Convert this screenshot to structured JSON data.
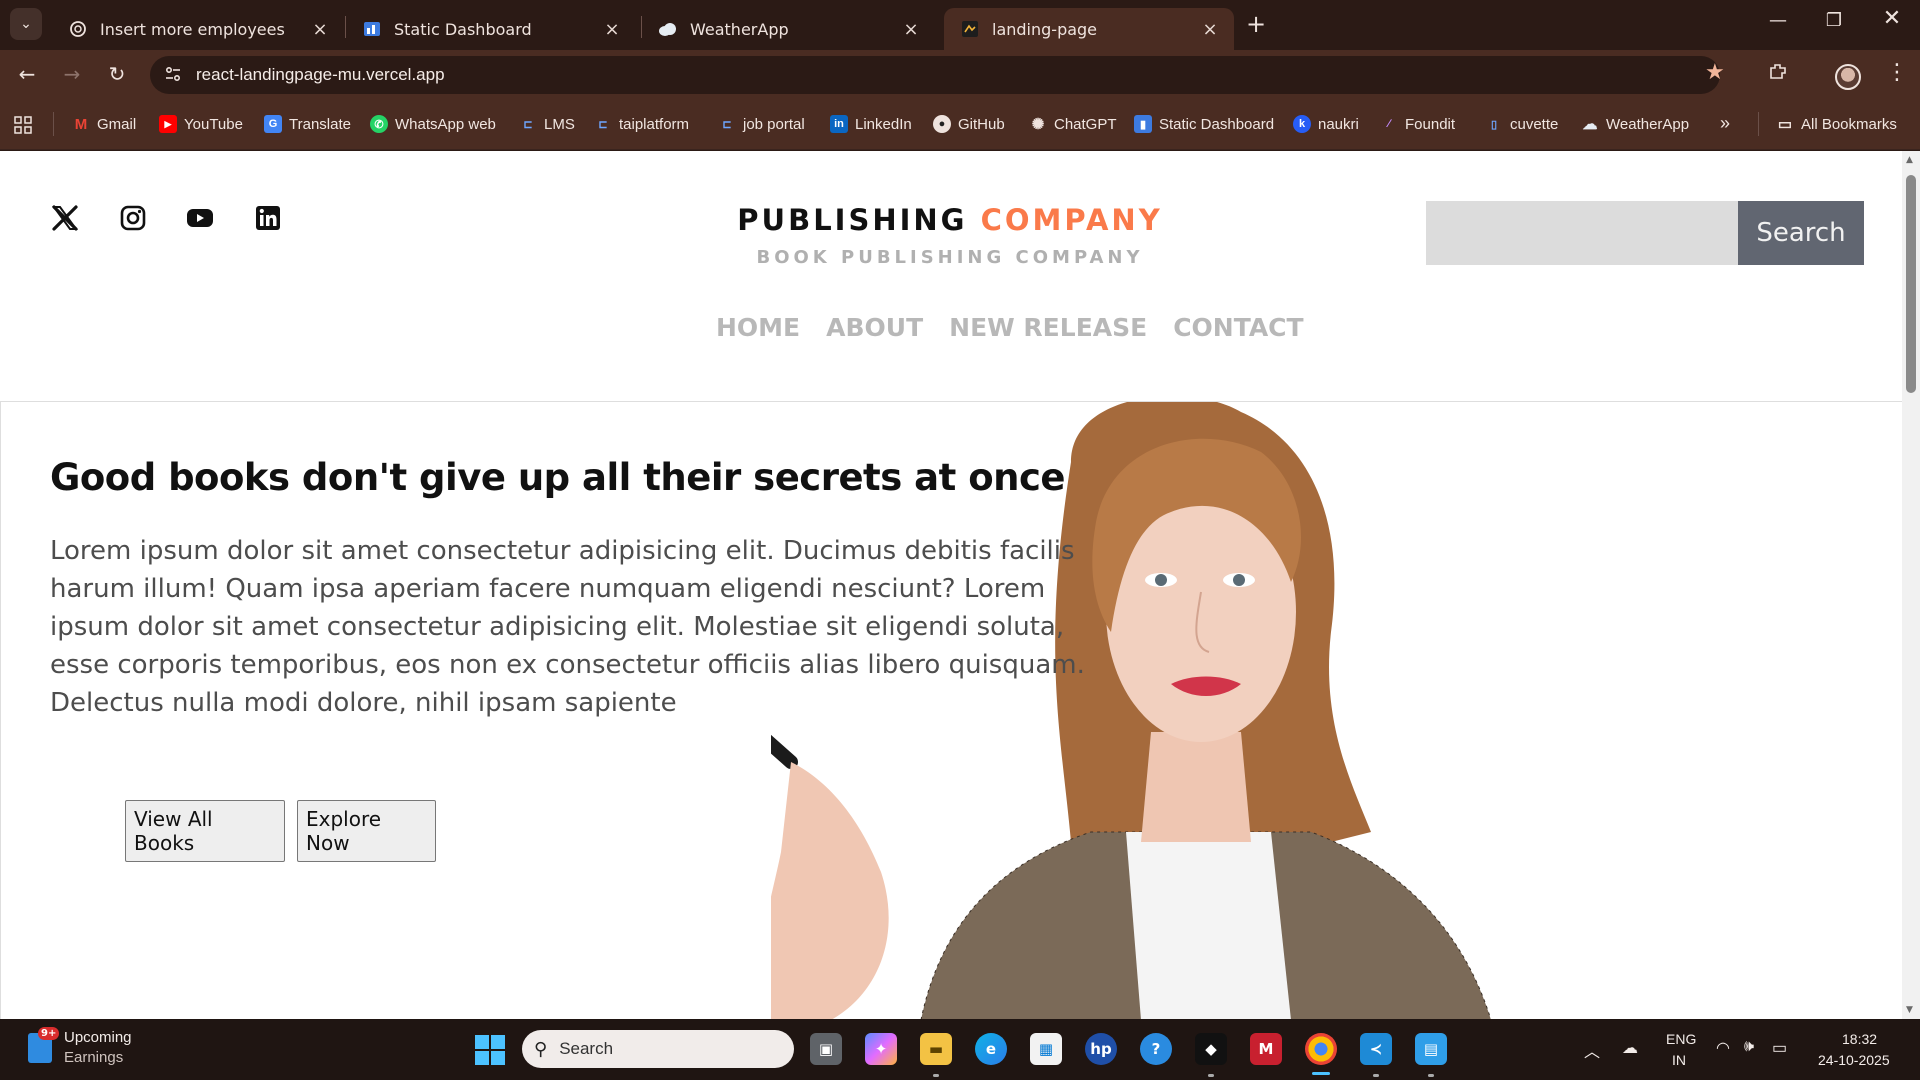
{
  "browser": {
    "tabs": [
      {
        "label": "Insert more employees",
        "icon": "chatgpt-icon",
        "active": false
      },
      {
        "label": "Static Dashboard",
        "icon": "dashboard-icon",
        "active": false
      },
      {
        "label": "WeatherApp",
        "icon": "cloud-icon",
        "active": false
      },
      {
        "label": "landing-page",
        "icon": "page-icon",
        "active": true
      }
    ],
    "url": "react-landingpage-mu.vercel.app",
    "bookmarks": [
      {
        "label": "Gmail",
        "icon": "gmail-icon",
        "color": "#ea4335"
      },
      {
        "label": "YouTube",
        "icon": "youtube-icon",
        "color": "#ff0000"
      },
      {
        "label": "Translate",
        "icon": "translate-icon",
        "color": "#4285f4"
      },
      {
        "label": "WhatsApp web",
        "icon": "whatsapp-icon",
        "color": "#25d366"
      },
      {
        "label": "LMS",
        "icon": "lms-icon",
        "color": "#3d7be0"
      },
      {
        "label": "taiplatform",
        "icon": "taiplatform-icon",
        "color": "#3d7be0"
      },
      {
        "label": "job portal",
        "icon": "job-portal-icon",
        "color": "#3d7be0"
      },
      {
        "label": "LinkedIn",
        "icon": "linkedin-icon",
        "color": "#0a66c2"
      },
      {
        "label": "GitHub",
        "icon": "github-icon",
        "color": "#333333"
      },
      {
        "label": "ChatGPT",
        "icon": "chatgpt-icon",
        "color": "#555555"
      },
      {
        "label": "Static Dashboard",
        "icon": "dashboard-icon",
        "color": "#3d7be0"
      },
      {
        "label": "naukri",
        "icon": "naukri-icon",
        "color": "#275df5"
      },
      {
        "label": "Foundit",
        "icon": "foundit-icon",
        "color": "#6e3cbc"
      },
      {
        "label": "cuvette",
        "icon": "cuvette-icon",
        "color": "#3d7be0"
      },
      {
        "label": "WeatherApp",
        "icon": "cloud-icon",
        "color": "#9aa6b2"
      }
    ],
    "all_bookmarks": "All Bookmarks"
  },
  "page": {
    "brand": {
      "title_main": "PUBLISHING",
      "title_accent": "COMPANY",
      "subtitle": "BOOK PUBLISHING COMPANY",
      "accent_color": "#fa7a4a"
    },
    "social": [
      "x-icon",
      "instagram-icon",
      "youtube-icon",
      "linkedin-icon"
    ],
    "search_button": "Search",
    "nav": [
      "HOME",
      "ABOUT",
      "NEW RELEASE",
      "CONTACT"
    ],
    "hero": {
      "title": "Good books don't give up all their secrets at once",
      "text": "Lorem ipsum dolor sit amet consectetur adipisicing elit. Ducimus debitis facilis harum illum! Quam ipsa aperiam facere numquam eligendi nesciunt? Lorem ipsum dolor sit amet consectetur adipisicing elit. Molestiae sit eligendi soluta, esse corporis temporibus, eos non ex consectetur officiis alias libero quisquam. Delectus nulla modi dolore, nihil ipsam sapiente",
      "buttons": [
        "View All Books",
        "Explore Now"
      ]
    }
  },
  "taskbar": {
    "widget_badge": "9+",
    "widget_title": "Upcoming",
    "widget_subtitle": "Earnings",
    "search_label": "Search",
    "lang_1": "ENG",
    "lang_2": "IN",
    "time": "18:32",
    "date": "24-10-2025"
  }
}
